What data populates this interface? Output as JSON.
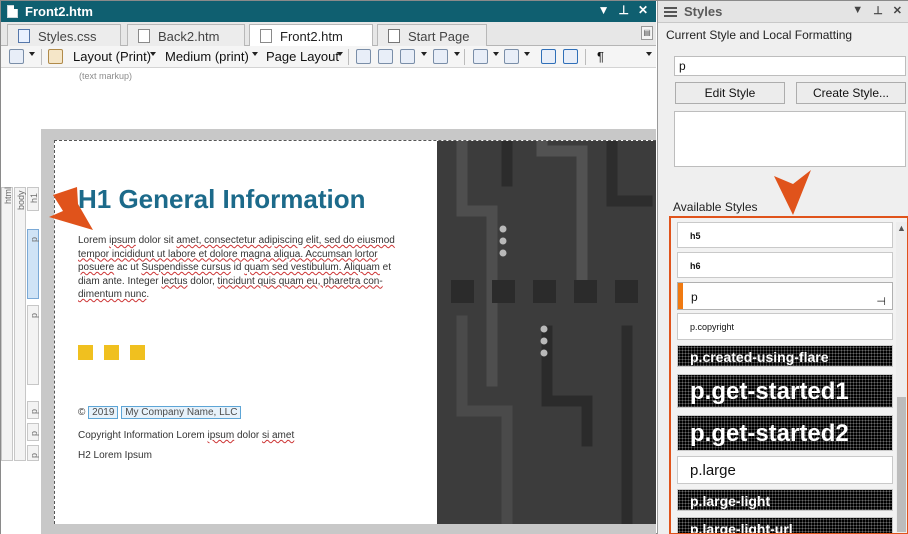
{
  "editor": {
    "window_title": "Front2.htm",
    "tabs": [
      {
        "label": "Styles.css",
        "icon": "css-file-icon"
      },
      {
        "label": "Back2.htm",
        "icon": "html-file-icon"
      },
      {
        "label": "Front2.htm",
        "icon": "html-file-icon",
        "active": true
      },
      {
        "label": "Start Page",
        "icon": "start-page-icon"
      }
    ],
    "toolbar": {
      "layout_label": "Layout (Print)",
      "medium_label": "Medium (print)",
      "page_layout_label": "Page Layout",
      "pilcrow": "¶"
    },
    "markup_hint": "(text markup)",
    "structure_labels": {
      "html": "html",
      "body": "body",
      "h1": "h1",
      "p": "p"
    }
  },
  "document": {
    "heading": "H1 General Information",
    "lorem": [
      {
        "t": "Lorem ",
        "sq": false
      },
      {
        "t": "ipsum",
        "sq": true
      },
      {
        "t": " dolor sit ",
        "sq": false
      },
      {
        "t": "amet, consectetur adipiscing elit, sed do eiusmod tempor incididunt ut labore et dolore magna aliqua. Accumsan lortor posuere",
        "sq": true
      },
      {
        "t": " ac ut ",
        "sq": false
      },
      {
        "t": "Suspendisse cursus",
        "sq": true
      },
      {
        "t": " id ",
        "sq": false
      },
      {
        "t": "quam sed vestibulum. Aliquam",
        "sq": true
      },
      {
        "t": " et diam ante. Integer ",
        "sq": false
      },
      {
        "t": "lectus",
        "sq": true
      },
      {
        "t": " dolor, ",
        "sq": false
      },
      {
        "t": "tincidunt quis quam eu, pharetra con-dimentum nunc",
        "sq": true
      },
      {
        "t": ".",
        "sq": false
      }
    ],
    "copyright_symbol": "©",
    "year_var": "2019",
    "company_var": "My Company Name, LLC",
    "copyright_info_pre": "Copyright Information Lorem ",
    "copyright_info_sq1": "ipsum",
    "copyright_info_mid": " dolor ",
    "copyright_info_sq2": "si amet",
    "h2": "H2 Lorem Ipsum"
  },
  "styles_pane": {
    "title": "Styles",
    "current_section_label": "Current Style and Local Formatting",
    "current_style_value": "p",
    "edit_style_label": "Edit Style",
    "create_style_label": "Create Style...",
    "available_label": "Available Styles",
    "styles": [
      {
        "name": "h5",
        "kind": "small"
      },
      {
        "name": "h6",
        "kind": "small"
      },
      {
        "name": "p",
        "kind": "selected"
      },
      {
        "name": "p.copyright",
        "kind": "small"
      },
      {
        "name": "p.created-using-flare",
        "kind": "dotted-md"
      },
      {
        "name": "p.get-started1",
        "kind": "dotted-lg"
      },
      {
        "name": "p.get-started2",
        "kind": "dotted-lg"
      },
      {
        "name": "p.large",
        "kind": "large"
      },
      {
        "name": "p.large-light",
        "kind": "dotted-md"
      },
      {
        "name": "p.large-light-url",
        "kind": "dotted-md"
      }
    ]
  },
  "colors": {
    "title_bar": "#0f5f70",
    "heading": "#1c6a8a",
    "accent_callout": "#e0531b",
    "selection": "#f07a12",
    "yellow": "#f0c01f"
  }
}
